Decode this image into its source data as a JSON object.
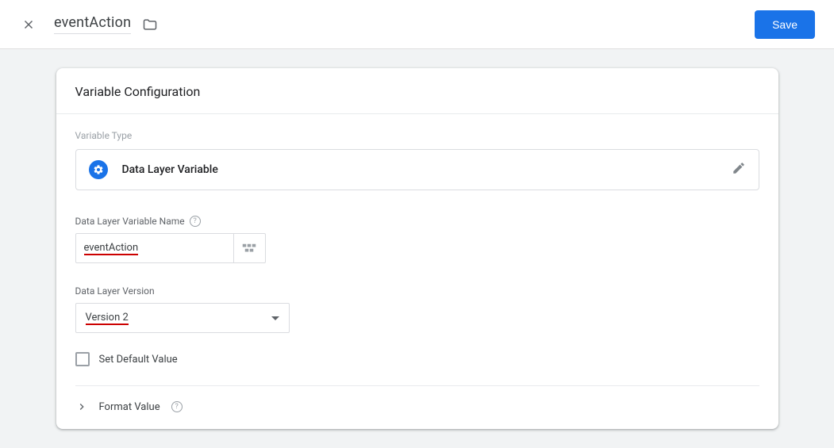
{
  "header": {
    "title": "eventAction",
    "save_label": "Save"
  },
  "card": {
    "title": "Variable Configuration",
    "type_section_label": "Variable Type",
    "type_name": "Data Layer Variable",
    "name_field": {
      "label": "Data Layer Variable Name",
      "value": "eventAction"
    },
    "version_field": {
      "label": "Data Layer Version",
      "value": "Version 2"
    },
    "default_checkbox_label": "Set Default Value",
    "format_label": "Format Value"
  }
}
